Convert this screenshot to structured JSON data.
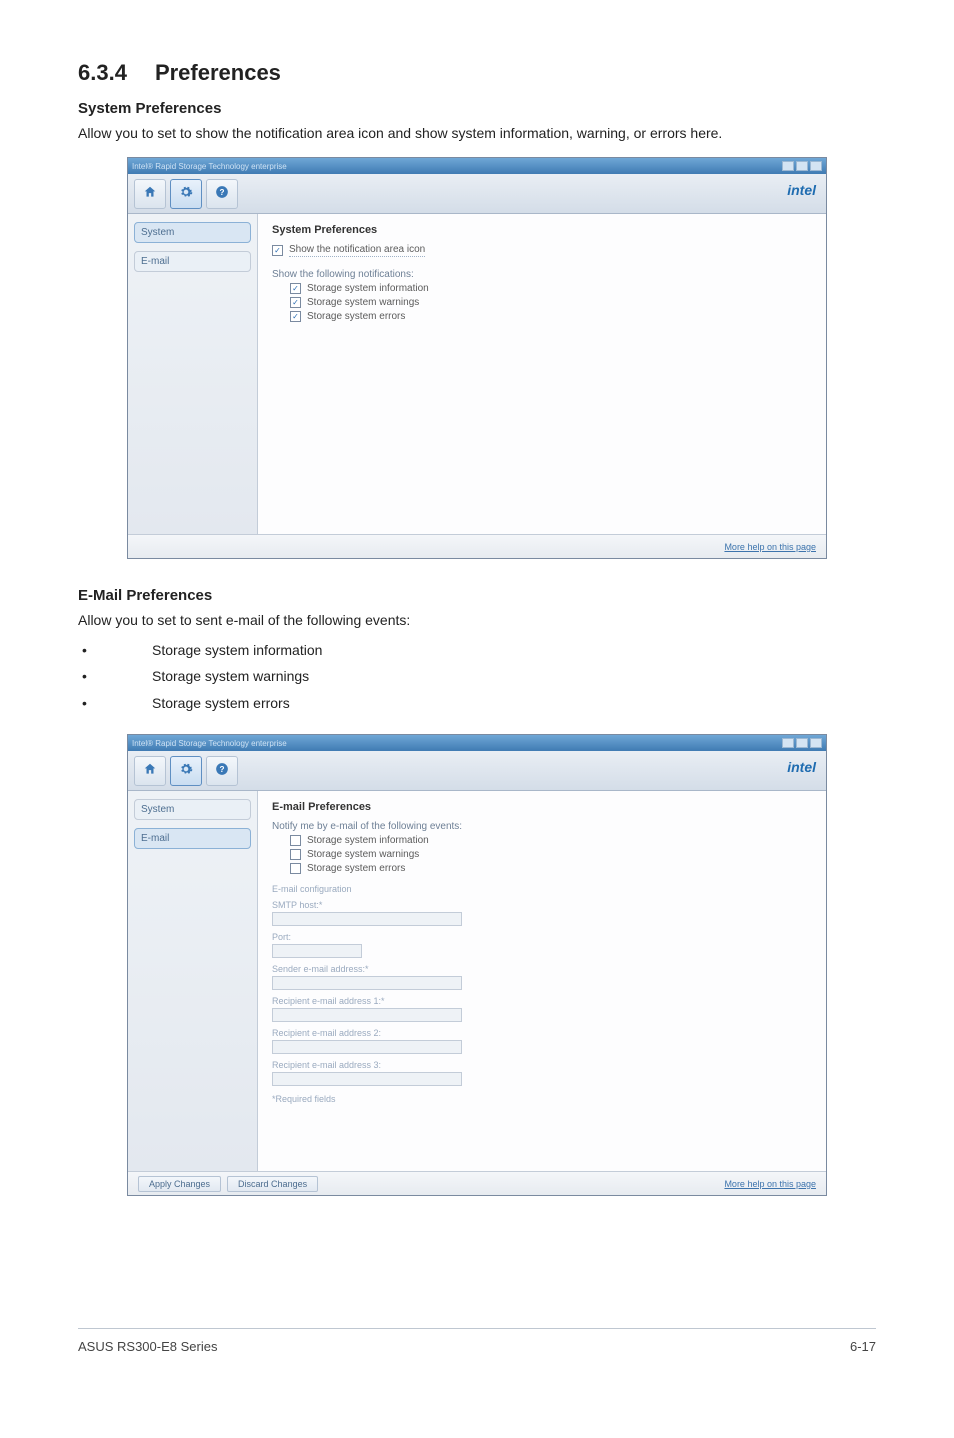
{
  "heading": {
    "number": "6.3.4",
    "title": "Preferences"
  },
  "sys": {
    "subhead": "System Preferences",
    "body": "Allow you to set to show the notification area icon and show system information, warning, or errors here.",
    "window_title": "Intel® Rapid Storage Technology enterprise",
    "brand": "intel",
    "side": {
      "system": "System",
      "email": "E-mail"
    },
    "panel_title": "System Preferences",
    "chk_main": "Show the notification area icon",
    "chk_group_label": "Show the following notifications:",
    "chk_info": "Storage system information",
    "chk_warn": "Storage system warnings",
    "chk_err": "Storage system errors",
    "footer_link": "More help on this page"
  },
  "email": {
    "subhead": "E-Mail Preferences",
    "body": "Allow you to set to sent e-mail of the following events:",
    "bullets": [
      "Storage system information",
      "Storage system warnings",
      "Storage system errors"
    ],
    "window_title": "Intel® Rapid Storage Technology enterprise",
    "brand": "intel",
    "side": {
      "system": "System",
      "email": "E-mail"
    },
    "panel_title": "E-mail Preferences",
    "notify_label": "Notify me by e-mail of the following events:",
    "chk_info": "Storage system information",
    "chk_warn": "Storage system warnings",
    "chk_err": "Storage system errors",
    "section_config": "E-mail configuration",
    "f_smtp": "SMTP host:*",
    "f_port": "Port:",
    "f_sender": "Sender e-mail address:*",
    "f_rec1": "Recipient e-mail address 1:*",
    "f_rec2": "Recipient e-mail address 2:",
    "f_rec3": "Recipient e-mail address 3:",
    "req": "*Required fields",
    "btn_apply": "Apply Changes",
    "btn_discard": "Discard Changes",
    "footer_link": "More help on this page"
  },
  "footer": {
    "left": "ASUS RS300-E8 Series",
    "right": "6-17"
  }
}
